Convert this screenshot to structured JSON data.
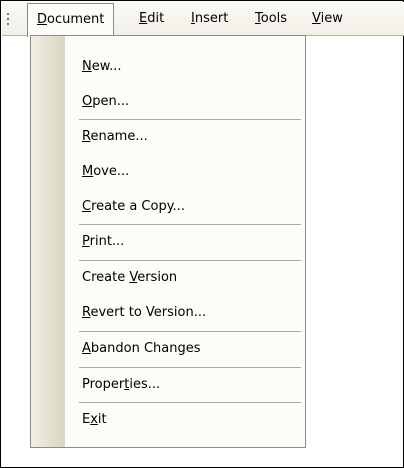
{
  "menubar": {
    "menus": [
      {
        "before": "",
        "key": "D",
        "after": "ocument"
      },
      {
        "before": "",
        "key": "E",
        "after": "dit"
      },
      {
        "before": "",
        "key": "I",
        "after": "nsert"
      },
      {
        "before": "",
        "key": "T",
        "after": "ools"
      },
      {
        "before": "",
        "key": "V",
        "after": "iew"
      }
    ]
  },
  "document_menu": {
    "items": [
      {
        "before": "",
        "key": "N",
        "after": "ew..."
      },
      {
        "before": "",
        "key": "O",
        "after": "pen..."
      },
      {
        "before": "",
        "key": "R",
        "after": "ename..."
      },
      {
        "before": "",
        "key": "M",
        "after": "ove..."
      },
      {
        "before": "",
        "key": "C",
        "after": "reate a Copy..."
      },
      {
        "before": "",
        "key": "P",
        "after": "rint..."
      },
      {
        "before": "Create ",
        "key": "V",
        "after": "ersion"
      },
      {
        "before": "",
        "key": "R",
        "after": "evert to Version..."
      },
      {
        "before": "",
        "key": "A",
        "after": "bandon Changes"
      },
      {
        "before": "Proper",
        "key": "t",
        "after": "ies..."
      },
      {
        "before": "E",
        "key": "x",
        "after": "it"
      }
    ]
  }
}
